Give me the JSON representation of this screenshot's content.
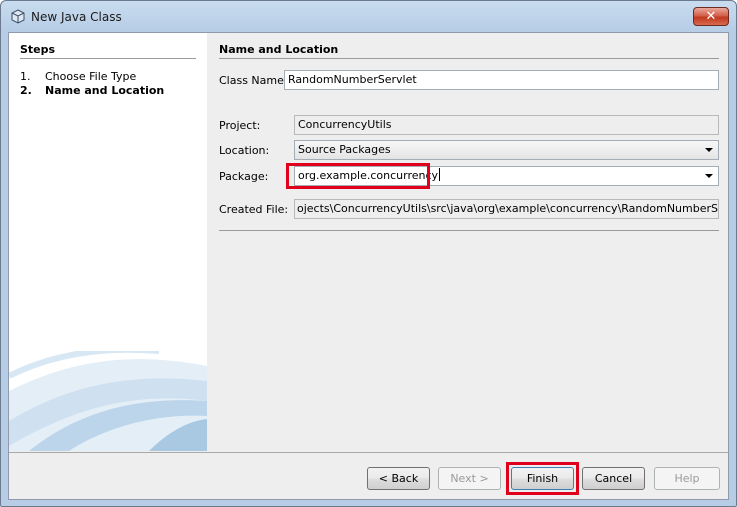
{
  "window": {
    "title": "New Java Class",
    "close_glyph": "✕"
  },
  "steps": {
    "title": "Steps",
    "items": [
      {
        "num": "1.",
        "label": "Choose File Type"
      },
      {
        "num": "2.",
        "label": "Name and Location"
      }
    ]
  },
  "panel": {
    "title": "Name and Location",
    "class_name_label": "Class Name:",
    "class_name_value": "RandomNumberServlet",
    "project_label": "Project:",
    "project_value": "ConcurrencyUtils",
    "location_label": "Location:",
    "location_value": "Source Packages",
    "package_label": "Package:",
    "package_value": "org.example.concurrency",
    "created_file_label": "Created File:",
    "created_file_value": "ojects\\ConcurrencyUtils\\src\\java\\org\\example\\concurrency\\RandomNumberServlet.java"
  },
  "buttons": {
    "back": "< Back",
    "next": "Next >",
    "finish": "Finish",
    "cancel": "Cancel",
    "help": "Help"
  },
  "colors": {
    "highlight": "#e0001b",
    "titlebar": "#c9dcef"
  }
}
